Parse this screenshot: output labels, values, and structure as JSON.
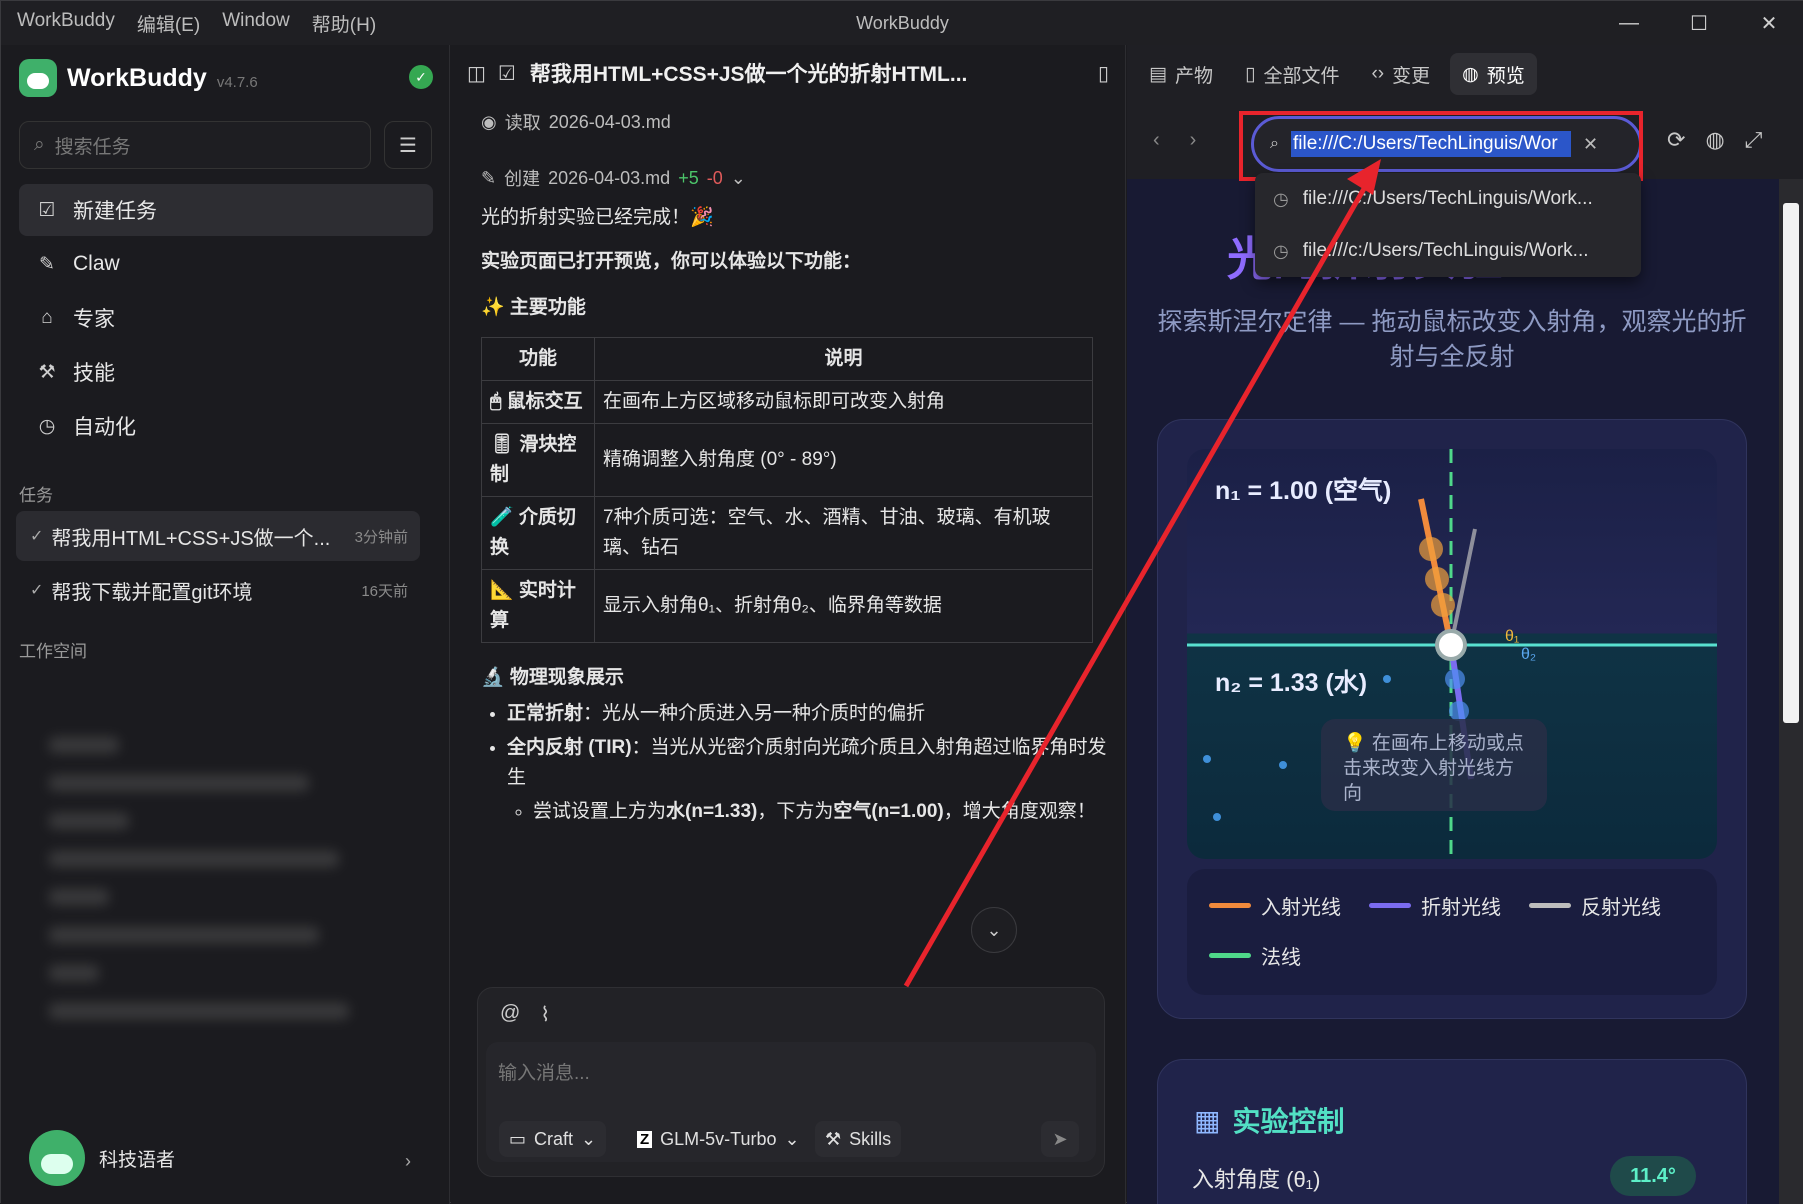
{
  "titlebar": {
    "menus": [
      "WorkBuddy",
      "编辑(E)",
      "Window",
      "帮助(H)"
    ],
    "title": "WorkBuddy"
  },
  "sidebar": {
    "brand": "WorkBuddy",
    "version": "v4.7.6",
    "search_placeholder": "搜索任务",
    "nav": [
      {
        "label": "新建任务",
        "icon": "edit-square-icon"
      },
      {
        "label": "Claw",
        "icon": "claw-icon"
      },
      {
        "label": "专家",
        "icon": "graduation-cap-icon"
      },
      {
        "label": "技能",
        "icon": "tools-icon"
      },
      {
        "label": "自动化",
        "icon": "clock-icon"
      }
    ],
    "tasks_label": "任务",
    "tasks": [
      {
        "title": "帮我用HTML+CSS+JS做一个...",
        "time": "3分钟前"
      },
      {
        "title": "帮我下载并配置git环境",
        "time": "16天前"
      }
    ],
    "workspace_label": "工作空间",
    "user": "科技语者"
  },
  "chat": {
    "title": "帮我用HTML+CSS+JS做一个光的折射HTML...",
    "read_action": "读取",
    "read_file": "2026-04-03.md",
    "create_action": "创建",
    "create_file": "2026-04-03.md",
    "added": "+5",
    "removed": "-0",
    "done_text": "光的折射实验已经完成！🎉",
    "intro": "实验页面已打开预览，你可以体验以下功能：",
    "features_heading": "✨ 主要功能",
    "table": {
      "headers": [
        "功能",
        "说明"
      ],
      "rows": [
        {
          "k": "🖱 鼠标交互",
          "v": "在画布上方区域移动鼠标即可改变入射角"
        },
        {
          "k": "🎚 滑块控制",
          "v": "精确调整入射角度 (0° - 89°)"
        },
        {
          "k": "🧪 介质切换",
          "v": "7种介质可选：空气、水、酒精、甘油、玻璃、有机玻璃、钻石"
        },
        {
          "k": "📐 实时计算",
          "v": "显示入射角θ₁、折射角θ₂、临界角等数据"
        }
      ]
    },
    "physics_heading": "🔬 物理现象展示",
    "physics": [
      {
        "b": "正常折射",
        "t": "：光从一种介质进入另一种介质时的偏折"
      },
      {
        "b": "全内反射 (TIR)",
        "t": "：当光从光密介质射向光疏介质且入射角超过临界角时发生"
      }
    ],
    "sub_bullet": {
      "a": "尝试设置上方为",
      "b1": "水(n=1.33)",
      "c": "，下方为",
      "b2": "空气(n=1.00)",
      "d": "，增大角度观察！"
    },
    "composer_placeholder": "输入消息...",
    "mode": "Craft",
    "model": "GLM-5v-Turbo",
    "skills": "Skills"
  },
  "preview": {
    "tabs": [
      "产物",
      "全部文件",
      "变更",
      "预览"
    ],
    "url": "file:///C:/Users/TechLinguis/Wor",
    "suggestions": [
      "file:///C:/Users/TechLinguis/Work...",
      "file:///c:/Users/TechLinguis/Work..."
    ],
    "title": "光的折射实验",
    "subtitle": "探索斯涅尔定律 — 拖动鼠标改变入射角，观察光的折射与全反射",
    "n1_label": "n₁ = 1.00 (空气)",
    "n2_label": "n₂ = 1.33 (水)",
    "theta1": "θ₁",
    "theta2": "θ₂",
    "hint": "💡 在画布上移动或点击来改变入射光线方向",
    "legend": [
      {
        "label": "入射光线",
        "color": "#f08a3c"
      },
      {
        "label": "折射光线",
        "color": "#7b6cf0"
      },
      {
        "label": "反射光线",
        "color": "#bdbdbd"
      },
      {
        "label": "法线",
        "color": "#4fd88a"
      }
    ],
    "controls_title": "实验控制",
    "angle_label": "入射角度 (θ₁)",
    "angle_value": "11.4°"
  }
}
